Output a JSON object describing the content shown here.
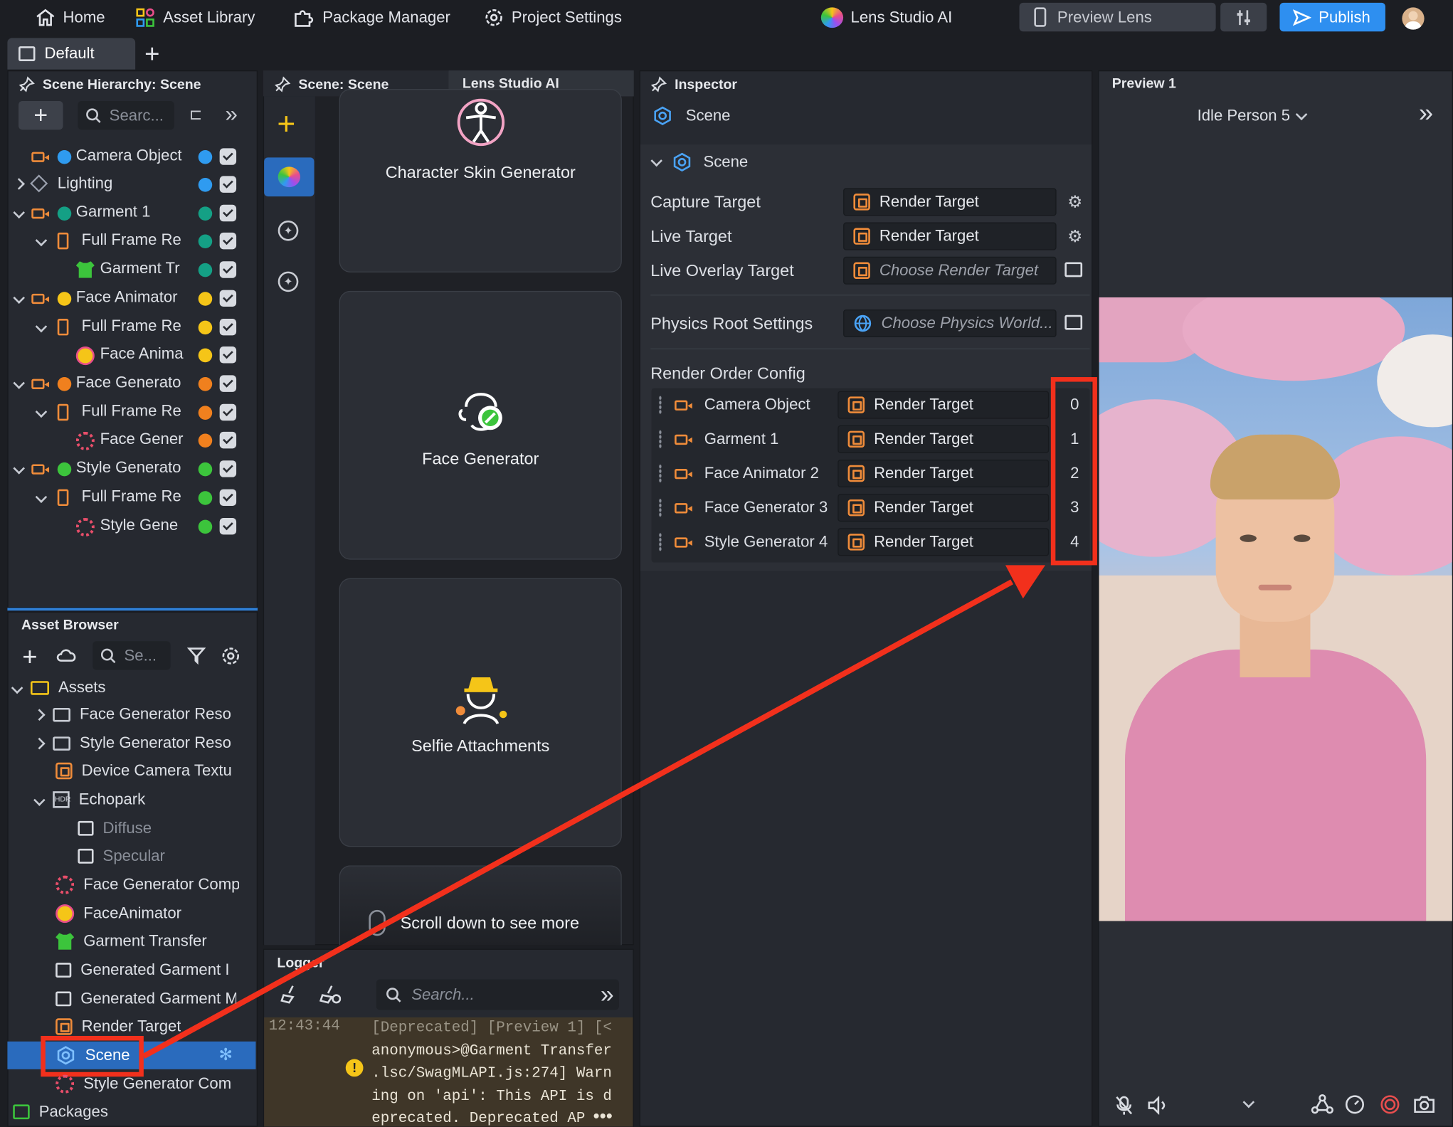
{
  "topbar": {
    "home": "Home",
    "asset_library": "Asset Library",
    "package_manager": "Package Manager",
    "project_settings": "Project Settings",
    "lens_studio_ai": "Lens Studio AI",
    "preview_lens": "Preview Lens",
    "publish": "Publish"
  },
  "layout": {
    "tab": "Default"
  },
  "hierarchy": {
    "title": "Scene Hierarchy: Scene",
    "search_placeholder": "Searc...",
    "items": [
      {
        "label": "Camera Object",
        "color": "#2f9bf0"
      },
      {
        "label": "Lighting",
        "color": "#2f9bf0"
      },
      {
        "label": "Garment 1",
        "color": "#14a085"
      },
      {
        "label": "Full Frame Re",
        "color": "#14a085"
      },
      {
        "label": "Garment Tr",
        "color": "#14a085"
      },
      {
        "label": "Face Animator",
        "color": "#f5c518"
      },
      {
        "label": "Full Frame Re",
        "color": "#f5c518"
      },
      {
        "label": "Face Anima",
        "color": "#f5c518"
      },
      {
        "label": "Face Generato",
        "color": "#f0801e"
      },
      {
        "label": "Full Frame Re",
        "color": "#f0801e"
      },
      {
        "label": "Face Gener",
        "color": "#f0801e"
      },
      {
        "label": "Style Generato",
        "color": "#3cc43c"
      },
      {
        "label": "Full Frame Re",
        "color": "#3cc43c"
      },
      {
        "label": "Style Gene",
        "color": "#3cc43c"
      }
    ]
  },
  "assets": {
    "title": "Asset Browser",
    "search_placeholder": "Se...",
    "root": "Assets",
    "items": [
      "Face Generator Reso",
      "Style Generator Reso",
      "Device Camera Textu",
      "Echopark",
      "Diffuse",
      "Specular",
      "Face Generator Comp",
      "FaceAnimator",
      "Garment Transfer",
      "Generated Garment I",
      "Generated Garment M",
      "Render Target",
      "Scene",
      "Style Generator Com"
    ],
    "packages": "Packages"
  },
  "scene_panel": {
    "tab_scene": "Scene: Scene",
    "tab_ai": "Lens Studio AI",
    "cards": [
      "Character Skin Generator",
      "Face Generator",
      "Selfie Attachments"
    ],
    "scroll_hint": "Scroll down to see more"
  },
  "logger": {
    "title": "Logger",
    "search_placeholder": "Search...",
    "timestamp": "12:43:44",
    "lines": [
      "[Deprecated] [Preview 1] [<",
      "anonymous>@Garment Transfer",
      ".lsc/SwagMLAPI.js:274] Warn",
      "ing on 'api': This API is d",
      "eprecated. Deprecated AP"
    ]
  },
  "inspector": {
    "title": "Inspector",
    "object": "Scene",
    "section": "Scene",
    "capture_label": "Capture Target",
    "capture_value": "Render Target",
    "live_label": "Live Target",
    "live_value": "Render Target",
    "overlay_label": "Live Overlay Target",
    "overlay_value": "Choose Render Target",
    "physics_label": "Physics Root Settings",
    "physics_value": "Choose Physics World...",
    "render_order_label": "Render Order Config",
    "render_order": [
      {
        "name": "Camera Object",
        "target": "Render Target",
        "index": "0"
      },
      {
        "name": "Garment 1",
        "target": "Render Target",
        "index": "1"
      },
      {
        "name": "Face Animator 2",
        "target": "Render Target",
        "index": "2"
      },
      {
        "name": "Face Generator 3",
        "target": "Render Target",
        "index": "3"
      },
      {
        "name": "Style Generator 4",
        "target": "Render Target",
        "index": "4"
      }
    ]
  },
  "preview": {
    "title": "Preview 1",
    "person_select": "Idle Person 5"
  },
  "colors": {
    "accent": "#2e8ff0",
    "annotation_red": "#f2301c",
    "orange_icon": "#f08c3a",
    "selection": "#2a6bbd"
  }
}
